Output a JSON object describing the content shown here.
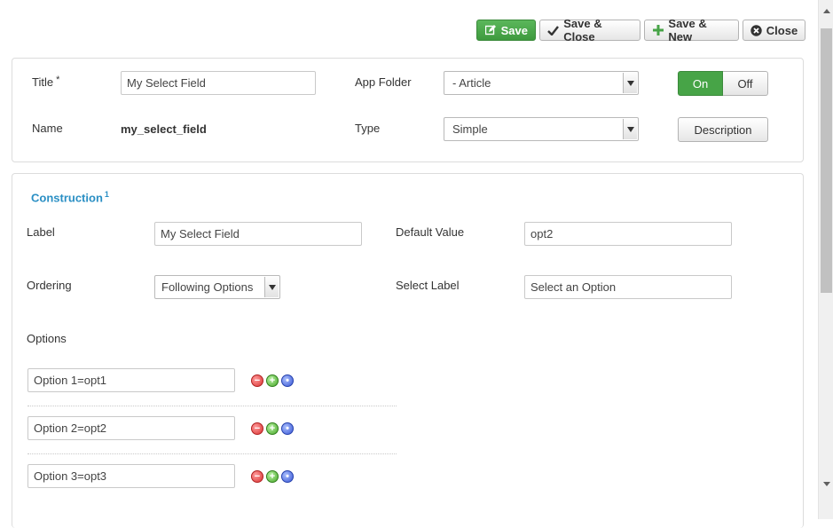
{
  "toolbar": {
    "save": "Save",
    "save_close": "Save & Close",
    "save_new": "Save & New",
    "close": "Close"
  },
  "header": {
    "title_label": "Title",
    "required_mark": "*",
    "title_value": "My Select Field",
    "name_label": "Name",
    "name_value": "my_select_field",
    "app_folder_label": "App Folder",
    "app_folder_value": "- Article",
    "type_label": "Type",
    "type_value": "Simple",
    "toggle_on": "On",
    "toggle_off": "Off",
    "toggle_state": "On",
    "description_button": "Description"
  },
  "construction": {
    "title": "Construction",
    "title_sup": "1",
    "label_label": "Label",
    "label_value": "My Select Field",
    "default_value_label": "Default Value",
    "default_value": "opt2",
    "ordering_label": "Ordering",
    "ordering_value": "Following Options",
    "select_label_label": "Select Label",
    "select_label_value": "Select an Option",
    "options_label": "Options",
    "options": [
      {
        "value": "Option 1=opt1"
      },
      {
        "value": "Option 2=opt2"
      },
      {
        "value": "Option 3=opt3"
      }
    ]
  },
  "colors": {
    "accent_blue": "#2a8fc4",
    "success_green": "#47a447"
  },
  "icons": {
    "save": "edit-icon",
    "save_close": "check-icon",
    "save_new": "plus-icon",
    "close": "close-circle-icon",
    "remove_option": "minus-circle-icon",
    "add_option": "plus-circle-icon",
    "sort_option": "dot-circle-icon"
  }
}
